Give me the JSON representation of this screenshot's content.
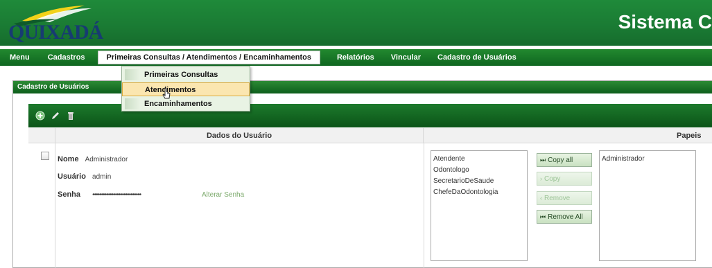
{
  "header": {
    "logo_text": "QUIXADÁ",
    "system_title": "Sistema C"
  },
  "menu": {
    "items": [
      {
        "label": "Menu"
      },
      {
        "label": "Cadastros"
      },
      {
        "label": "Primeiras Consultas / Atendimentos / Encaminhamentos"
      },
      {
        "label": "Relatórios"
      },
      {
        "label": "Vincular"
      },
      {
        "label": "Cadastro de Usuários"
      }
    ],
    "dropdown": [
      {
        "label": "Primeiras Consultas"
      },
      {
        "label": "Atendimentos"
      },
      {
        "label": "Encaminhamentos"
      }
    ]
  },
  "panel": {
    "title": "Cadastro de Usuários",
    "toolbar_icons": [
      "add-icon",
      "edit-icon",
      "delete-icon"
    ],
    "columns": {
      "dados": "Dados do Usuário",
      "papeis": "Papeis"
    },
    "user": {
      "nome_label": "Nome",
      "nome_value": "Administrador",
      "usuario_label": "Usuário",
      "usuario_value": "admin",
      "senha_label": "Senha",
      "senha_value": "••••••••••••••••••••••••••••",
      "alterar_senha": "Alterar Senha"
    },
    "available_roles": [
      "Atendente",
      "Odontologo",
      "SecretarioDeSaude",
      "ChefeDaOdontologia"
    ],
    "assigned_roles": [
      "Administrador"
    ],
    "buttons": {
      "copy_all": "Copy all",
      "copy": "Copy",
      "remove": "Remove",
      "remove_all": "Remove All"
    }
  },
  "colors": {
    "brand_green": "#1a7a33",
    "menu_highlight": "#fbe6b0"
  }
}
